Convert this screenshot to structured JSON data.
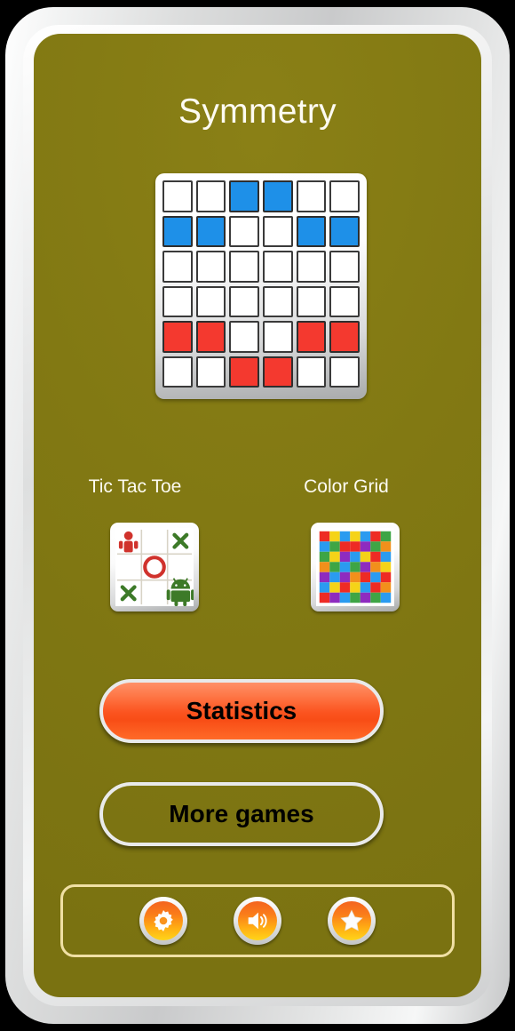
{
  "app": {
    "title": "Symmetry",
    "screen_bg": "#827913",
    "frame_color": "#dcdddd",
    "title_color": "#fdfbf2"
  },
  "hero_board": {
    "name": "symmetry-preview-grid",
    "rows": 6,
    "cols": 6,
    "colors": {
      "blue": "#1e90e8",
      "red": "#f4392f",
      "empty": "#ffffff"
    },
    "cells": [
      [
        "e",
        "e",
        "b",
        "b",
        "e",
        "e"
      ],
      [
        "b",
        "b",
        "e",
        "e",
        "b",
        "b"
      ],
      [
        "e",
        "e",
        "e",
        "e",
        "e",
        "e"
      ],
      [
        "e",
        "e",
        "e",
        "e",
        "e",
        "e"
      ],
      [
        "r",
        "r",
        "e",
        "e",
        "r",
        "r"
      ],
      [
        "e",
        "e",
        "r",
        "r",
        "e",
        "e"
      ]
    ]
  },
  "games": [
    {
      "label": "Tic Tac Toe",
      "thumb": "tic-tac-toe-thumbnail"
    },
    {
      "label": "Color Grid",
      "thumb": "color-grid-thumbnail"
    }
  ],
  "tictactoe_thumb": {
    "grid_line_color": "#d8d3c6",
    "marks": [
      [
        "human",
        "empty",
        "x"
      ],
      [
        "empty",
        "o",
        "empty"
      ],
      [
        "x",
        "empty",
        "android"
      ]
    ],
    "colors": {
      "red": "#d0322c",
      "green": "#3d7a28"
    }
  },
  "colorgrid_thumb": {
    "rows": 7,
    "cols": 7,
    "palette": {
      "r": "#ee2b24",
      "y": "#f5d318",
      "b": "#2a9bf0",
      "g": "#3ea545",
      "p": "#8e2bbf",
      "o": "#f2901b"
    },
    "cells": [
      [
        "r",
        "y",
        "b",
        "y",
        "b",
        "r",
        "g"
      ],
      [
        "b",
        "g",
        "r",
        "r",
        "p",
        "g",
        "o"
      ],
      [
        "g",
        "y",
        "p",
        "b",
        "y",
        "r",
        "b"
      ],
      [
        "o",
        "g",
        "b",
        "g",
        "p",
        "o",
        "y"
      ],
      [
        "p",
        "b",
        "p",
        "o",
        "r",
        "b",
        "r"
      ],
      [
        "b",
        "y",
        "r",
        "y",
        "b",
        "r",
        "o"
      ],
      [
        "r",
        "p",
        "b",
        "g",
        "p",
        "g",
        "b"
      ]
    ]
  },
  "buttons": {
    "statistics": {
      "label": "Statistics",
      "color": "#fb5420"
    },
    "more_games": {
      "label": "More games",
      "color": "#ffa02c"
    }
  },
  "toolbar": {
    "border_color": "#f0e0a4",
    "items": [
      {
        "icon": "gear-icon",
        "name": "settings-button"
      },
      {
        "icon": "speaker-icon",
        "name": "sound-button"
      },
      {
        "icon": "star-icon",
        "name": "rate-button"
      }
    ]
  }
}
